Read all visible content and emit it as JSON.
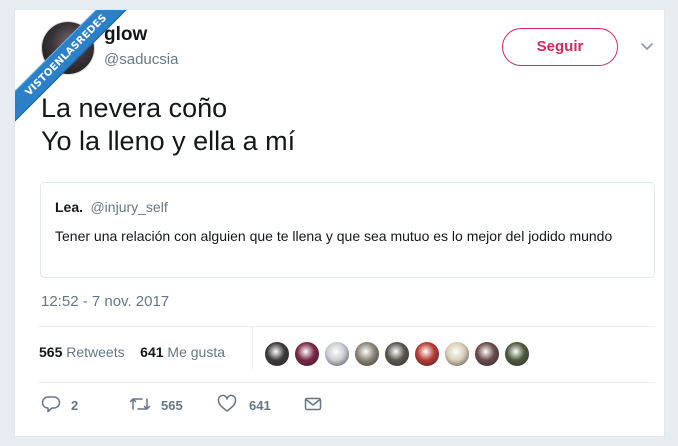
{
  "watermark": {
    "text": "VISTOENLASREDES"
  },
  "author": {
    "display_name": "glow",
    "handle": "@saducsia"
  },
  "follow_button": {
    "label": "Seguir"
  },
  "tweet": {
    "lines": [
      "La nevera coño",
      "Yo la lleno y ella a mí"
    ]
  },
  "quote": {
    "name": "Lea.",
    "handle": "@injury_self",
    "text": "Tener una relación con alguien que te llena y que sea mutuo es lo mejor del jodido mundo"
  },
  "timestamp": "12:52 - 7 nov. 2017",
  "stats": {
    "retweets_count": "565",
    "retweets_label": "Retweets",
    "likes_count": "641",
    "likes_label": "Me gusta"
  },
  "likers": [
    {
      "name": "liker-1",
      "color": "#3d3a3c"
    },
    {
      "name": "liker-2",
      "color": "#7a2648"
    },
    {
      "name": "liker-3",
      "color": "#c9ccd2"
    },
    {
      "name": "liker-4",
      "color": "#8a8576"
    },
    {
      "name": "liker-5",
      "color": "#5c5650"
    },
    {
      "name": "liker-6",
      "color": "#b73a34"
    },
    {
      "name": "liker-7",
      "color": "#d9cfb8"
    },
    {
      "name": "liker-8",
      "color": "#6b4a4c"
    },
    {
      "name": "liker-9",
      "color": "#4f5a3e"
    }
  ],
  "actions": {
    "reply_count": "2",
    "retweet_count": "565",
    "like_count": "641"
  },
  "colors": {
    "accent": "#e0245e",
    "muted": "#657786",
    "text": "#14171a",
    "watermark": "#2b80c8"
  }
}
